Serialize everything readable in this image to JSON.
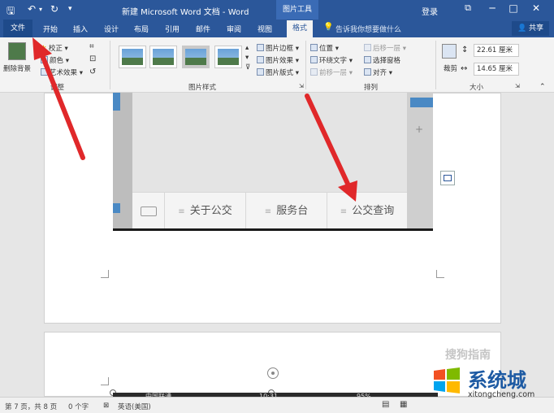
{
  "titlebar": {
    "doc_title": "新建 Microsoft Word 文档 - Word",
    "tools_tab": "图片工具",
    "login": "登录",
    "minimize": "─",
    "restore": "□",
    "close": "✕",
    "ribbon_display": "⧉"
  },
  "tabs": {
    "file": "文件",
    "home": "开始",
    "insert": "插入",
    "design": "设计",
    "layout": "布局",
    "references": "引用",
    "mailings": "邮件",
    "review": "审阅",
    "view": "视图",
    "format": "格式",
    "tell_me": "告诉我你想要做什么",
    "share": "共享"
  },
  "ribbon": {
    "remove_background": "删除背景",
    "corrections": "校正 ▾",
    "color": "颜色 ▾",
    "artistic_effects": "艺术效果 ▾",
    "adjust_group": "调整",
    "picture_border": "图片边框 ▾",
    "picture_effects": "图片效果 ▾",
    "picture_layout": "图片版式 ▾",
    "picture_styles_group": "图片样式",
    "position": "位置 ▾",
    "wrap_text": "环绕文字 ▾",
    "bring_forward": "前移一层 ▾",
    "send_backward": "后移一层 ▾",
    "selection_pane": "选择窗格",
    "align": "对齐 ▾",
    "arrange_group": "排列",
    "crop": "裁剪",
    "height": "22.61 厘米",
    "width": "14.65 厘米",
    "size_group": "大小"
  },
  "document": {
    "menu_items": [
      "关于公交",
      "服务台",
      "公交查询"
    ],
    "phone_status": "中国联通",
    "phone_time": "10:31",
    "phone_battery": "95%",
    "watermark": "搜狗指南"
  },
  "statusbar": {
    "page": "第 7 页，共 8 页",
    "words": "0 个字",
    "language": "英语(美国)"
  },
  "logo": {
    "name": "系统城",
    "url": "xitongcheng.com"
  },
  "colors": {
    "word_blue": "#2b579a",
    "arrow_red": "#e0282a"
  }
}
